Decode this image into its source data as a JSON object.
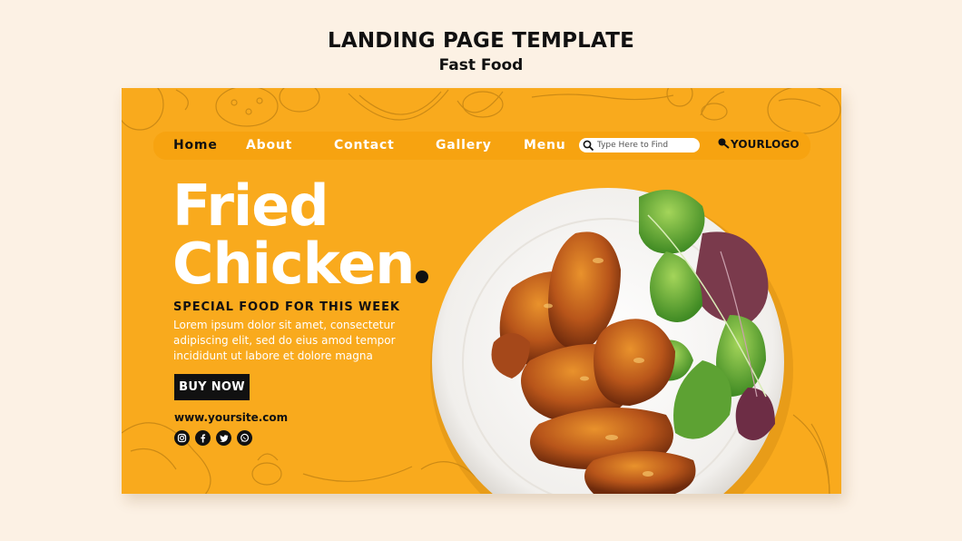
{
  "page_header": {
    "title": "LANDING PAGE TEMPLATE",
    "subtitle": "Fast Food"
  },
  "nav": {
    "items": [
      {
        "label": "Home",
        "active": true
      },
      {
        "label": "About"
      },
      {
        "label": "Contact"
      },
      {
        "label": "Gallery"
      },
      {
        "label": "Menu"
      }
    ],
    "search_placeholder": "Type Here to Find",
    "logo": "YOURLOGO"
  },
  "hero": {
    "headline_line1": "Fried",
    "headline_line2": "Chicken",
    "subheading": "SPECIAL FOOD FOR THIS WEEK",
    "body_lines": [
      "Lorem ipsum dolor sit amet, consectetur",
      "adipiscing elit, sed do eius amod tempor",
      "incididunt ut labore et dolore magna"
    ],
    "cta_label": "BUY NOW",
    "website": "www.yoursite.com",
    "socials": [
      "instagram-icon",
      "facebook-icon",
      "twitter-icon",
      "whatsapp-icon"
    ]
  },
  "colors": {
    "background": "#fcf1e4",
    "card": "#f9aa1d",
    "nav_bar": "#f7a310",
    "dark": "#111111",
    "white": "#ffffff"
  }
}
